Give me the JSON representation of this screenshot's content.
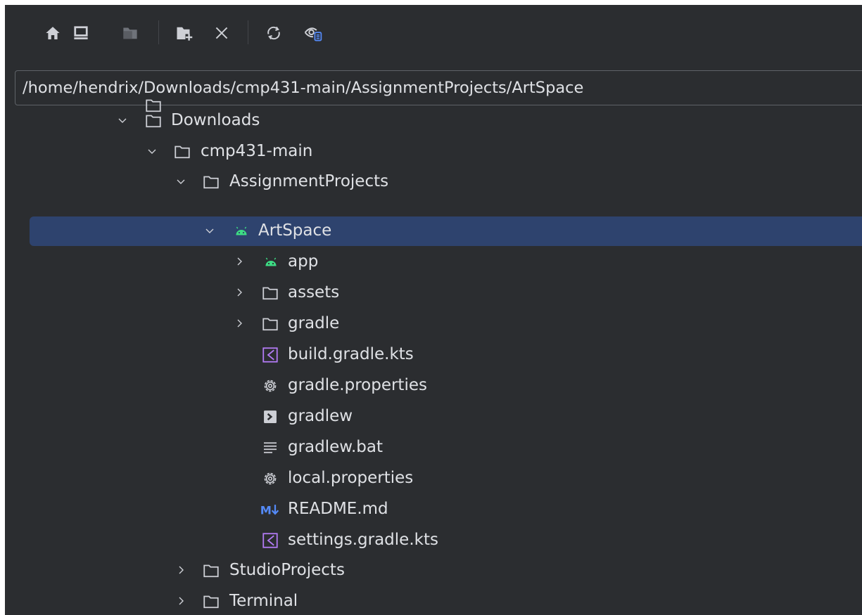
{
  "toolbar": {
    "buttons": [
      {
        "name": "home-icon"
      },
      {
        "name": "desktop-icon"
      },
      {
        "name": "project-folder-icon"
      },
      {
        "name": "new-folder-icon"
      },
      {
        "name": "delete-icon"
      },
      {
        "name": "refresh-icon"
      },
      {
        "name": "show-hidden-icon"
      }
    ]
  },
  "path": {
    "value": "/home/hendrix/Downloads/cmp431-main/AssignmentProjects/ArtSpace"
  },
  "tree": {
    "items": [
      {
        "label": "Downloads",
        "icon": "folder-icon",
        "expanded": true
      },
      {
        "label": "cmp431-main",
        "icon": "folder-icon",
        "expanded": true
      },
      {
        "label": "AssignmentProjects",
        "icon": "folder-icon",
        "expanded": true
      },
      {
        "label": "ArtSpace",
        "icon": "android-icon",
        "expanded": true,
        "selected": true
      },
      {
        "label": "app",
        "icon": "android-icon",
        "expanded": false
      },
      {
        "label": "assets",
        "icon": "folder-icon",
        "expanded": false
      },
      {
        "label": "gradle",
        "icon": "folder-icon",
        "expanded": false
      },
      {
        "label": "build.gradle.kts",
        "icon": "kotlin-icon"
      },
      {
        "label": "gradle.properties",
        "icon": "settings-gear-icon"
      },
      {
        "label": "gradlew",
        "icon": "terminal-icon"
      },
      {
        "label": "gradlew.bat",
        "icon": "text-lines-icon"
      },
      {
        "label": "local.properties",
        "icon": "settings-gear-icon"
      },
      {
        "label": "README.md",
        "icon": "markdown-icon"
      },
      {
        "label": "settings.gradle.kts",
        "icon": "kotlin-icon"
      },
      {
        "label": "StudioProjects",
        "icon": "folder-icon",
        "expanded": false
      },
      {
        "label": "Terminal",
        "icon": "folder-icon",
        "expanded": false
      }
    ]
  },
  "colors": {
    "background": "#2b2d30",
    "text": "#dfe1e5",
    "selection": "#2e436e",
    "android": "#3ddc84",
    "kotlin": "#b37bf5",
    "markdown": "#548af7"
  }
}
